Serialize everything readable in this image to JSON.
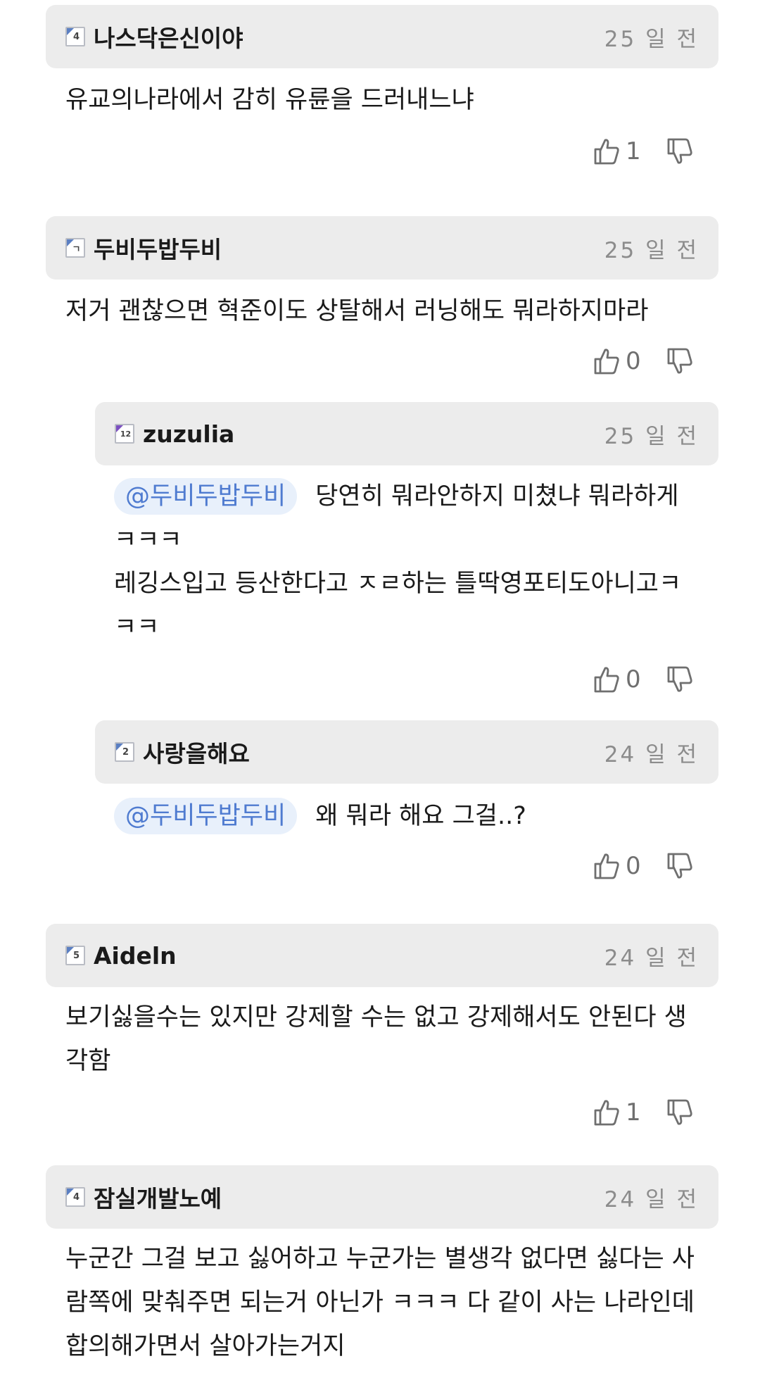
{
  "comments": [
    {
      "user": "나스닥은신이야",
      "level": "4",
      "time": "25 일 전",
      "text_lines": [
        "유교의나라에서 감히 유륜을 드러내느냐"
      ],
      "likes": "1"
    },
    {
      "user": "두비두밥두비",
      "level": "ㄱ",
      "time": "25 일 전",
      "text_lines": [
        "저거 괜찮으면 혁준이도 상탈해서 러닝해도 뭐라하지마라"
      ],
      "likes": "0",
      "replies": [
        {
          "user": "zuzulia",
          "level": "12",
          "time": "25 일 전",
          "mention": "@두비두밥두비",
          "first_line": "당연히 뭐라안하지 미쳤냐 뭐라하게",
          "text_lines": [
            "ㅋㅋㅋ",
            "레깅스입고 등산한다고 ㅈㄹ하는 틀딱영포티도아니고ㅋ",
            "ㅋㅋ"
          ],
          "likes": "0"
        },
        {
          "user": "사랑을해요",
          "level": "2",
          "time": "24 일 전",
          "mention": "@두비두밥두비",
          "first_line": "왜 뭐라 해요 그걸..?",
          "text_lines": [],
          "likes": "0"
        }
      ]
    },
    {
      "user": "Aideln",
      "level": "5",
      "time": "24 일 전",
      "text_lines": [
        "보기싫을수는 있지만 강제할 수는 없고 강제해서도 안된다 생",
        "각함"
      ],
      "likes": "1"
    },
    {
      "user": "잠실개발노예",
      "level": "4",
      "time": "24 일 전",
      "text_lines": [
        "누군간 그걸 보고 싫어하고 누군가는 별생각 없다면 싫다는 사",
        "람쪽에 맞춰주면 되는거 아닌가 ㅋㅋㅋ 다 같이 사는 나라인데",
        "합의해가면서 살아가는거지"
      ]
    }
  ],
  "icons": {
    "like": "thumbs-up-icon",
    "dislike": "thumbs-down-icon"
  },
  "colors": {
    "header_bg": "#ececec",
    "mention_text": "#4f7bd0",
    "mention_bg": "#e8f0fb",
    "time": "#8c8c8c"
  }
}
